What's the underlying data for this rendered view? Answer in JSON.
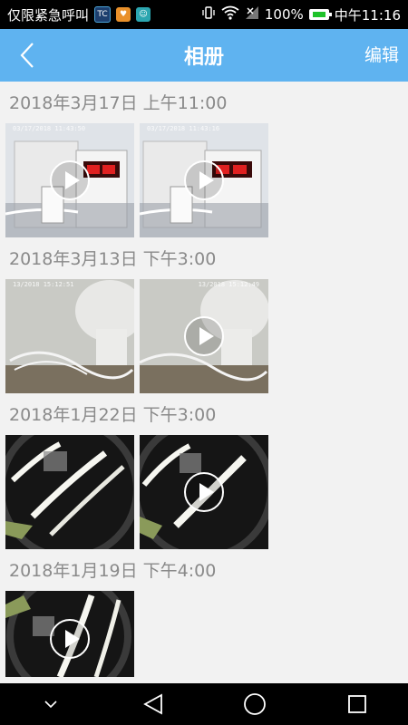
{
  "status_bar": {
    "carrier": "仅限紧急呼叫",
    "app_icons": [
      "tc-app-icon",
      "orange-app-icon",
      "teal-app-icon"
    ],
    "battery": "100%",
    "time": "中午11:16",
    "icons": [
      "vibrate-icon",
      "wifi-icon",
      "signal-icon",
      "battery-icon"
    ]
  },
  "header": {
    "title": "相册",
    "edit_label": "编辑",
    "back_icon": "chevron-left-icon",
    "background": "#5fb3f0"
  },
  "groups": [
    {
      "date": "2018年3月17日 上午11:00",
      "items": [
        {
          "timestamp": "03/17/2018 11:43:50"
        },
        {
          "timestamp": "03/17/2018 11:43:16"
        }
      ]
    },
    {
      "date": "2018年3月13日 下午3:00",
      "items": [
        {
          "timestamp": "13/2018 15:12:51"
        },
        {
          "timestamp": "13/2018 15:12:49"
        }
      ]
    },
    {
      "date": "2018年1月22日 下午3:00",
      "items": [
        {
          "timestamp": ""
        },
        {
          "timestamp": ""
        }
      ]
    },
    {
      "date": "2018年1月19日 下午4:00",
      "items": [
        {
          "timestamp": ""
        }
      ]
    }
  ],
  "nav_bar": {
    "icons": [
      "chevron-down-icon",
      "back-triangle-icon",
      "home-circle-icon",
      "recents-square-icon"
    ]
  }
}
